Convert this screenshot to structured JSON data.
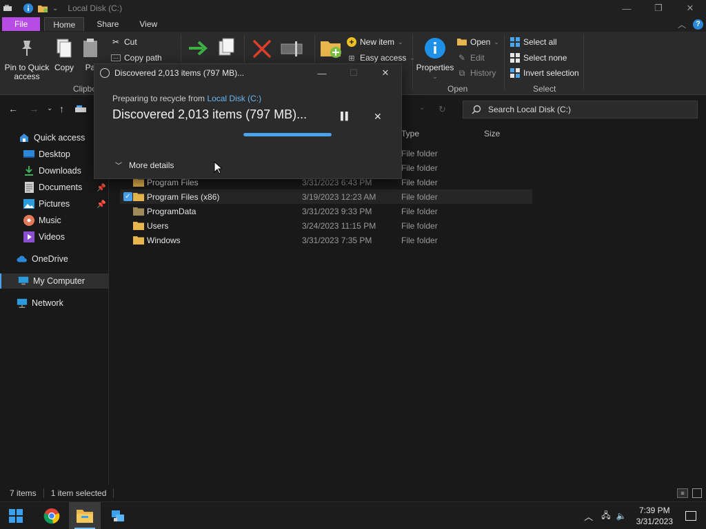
{
  "window": {
    "title": "Local Disk (C:)",
    "minimize": "—",
    "maximize": "❐",
    "close": "✕"
  },
  "tabs": {
    "file": "File",
    "home": "Home",
    "share": "Share",
    "view": "View",
    "collapse": "︿",
    "help": "?"
  },
  "ribbon": {
    "pin_quick_access": "Pin to Quick access",
    "copy": "Copy",
    "paste": "Pa",
    "cut": "Cut",
    "copy_path": "Copy path",
    "clipboard_group": "Clipbo",
    "new_item": "New item",
    "easy_access": "Easy access",
    "properties": "Properties",
    "open": "Open",
    "edit": "Edit",
    "history": "History",
    "open_group": "Open",
    "select_all": "Select all",
    "select_none": "Select none",
    "invert_selection": "Invert selection",
    "select_group": "Select"
  },
  "search": {
    "placeholder": "Search Local Disk (C:)"
  },
  "columns": {
    "type": "Type",
    "size": "Size"
  },
  "nav": {
    "quick_access": "Quick access",
    "desktop": "Desktop",
    "downloads": "Downloads",
    "documents": "Documents",
    "pictures": "Pictures",
    "music": "Music",
    "videos": "Videos",
    "onedrive": "OneDrive",
    "my_computer": "My Computer",
    "network": "Network"
  },
  "files": [
    {
      "name": "",
      "date": "",
      "type": "File folder"
    },
    {
      "name": "",
      "date": "",
      "type": "File folder"
    },
    {
      "name": "Program Files",
      "date": "3/31/2023 6:43 PM",
      "type": "File folder"
    },
    {
      "name": "Program Files (x86)",
      "date": "3/19/2023 12:23 AM",
      "type": "File folder"
    },
    {
      "name": "ProgramData",
      "date": "3/31/2023 9:33 PM",
      "type": "File folder"
    },
    {
      "name": "Users",
      "date": "3/24/2023 11:15 PM",
      "type": "File folder"
    },
    {
      "name": "Windows",
      "date": "3/31/2023 7:35 PM",
      "type": "File folder"
    }
  ],
  "status": {
    "items": "7 items",
    "selected": "1 item selected"
  },
  "dialog": {
    "title": "Discovered 2,013 items (797 MB)...",
    "preparing": "Preparing to recycle from",
    "location": "Local Disk (C:)",
    "heading": "Discovered 2,013 items (797 MB)...",
    "progress": 1.0,
    "more_details": "More details"
  },
  "taskbar": {
    "time": "7:39 PM",
    "date": "3/31/2023"
  },
  "colors": {
    "file_tab": "#b64ce3",
    "accent": "#4aa3ef",
    "link": "#6cb8f5"
  }
}
